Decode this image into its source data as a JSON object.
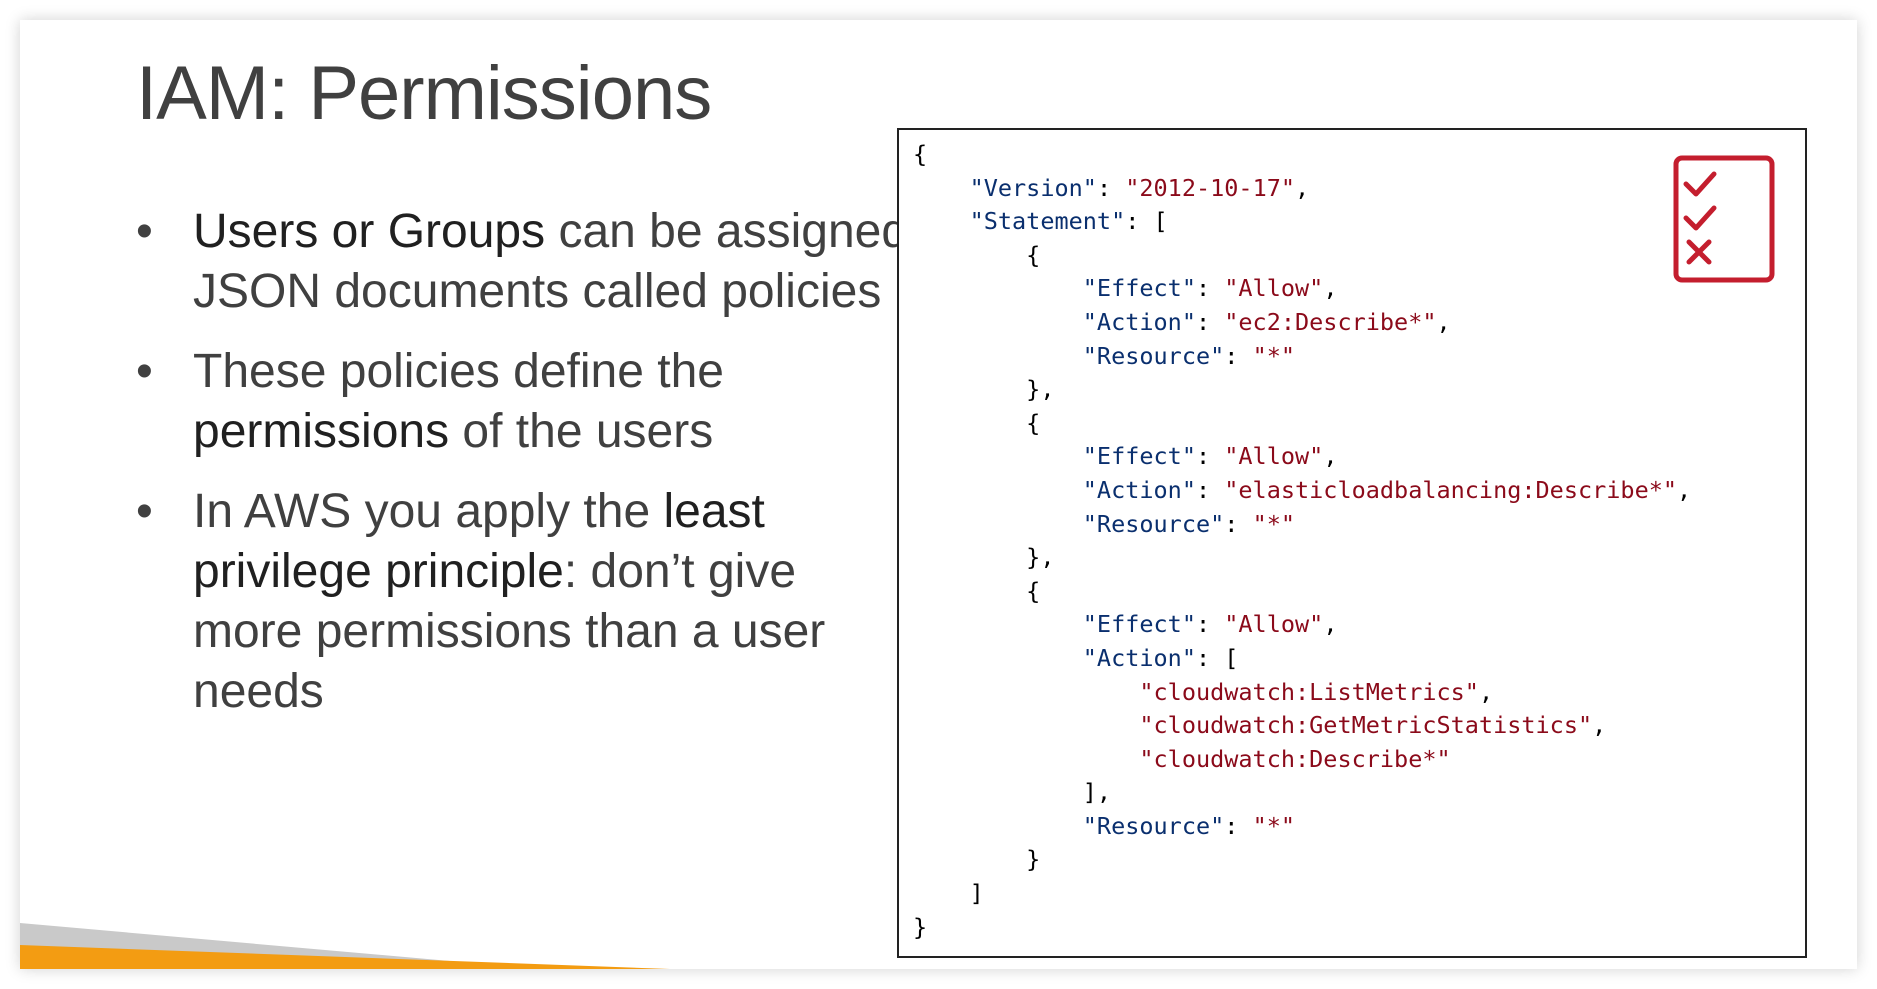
{
  "slide": {
    "title": "IAM: Permissions",
    "bullets": [
      [
        {
          "text": "Users or Groups",
          "em": true
        },
        {
          "text": " can be assigned JSON documents called policies",
          "em": false
        }
      ],
      [
        {
          "text": "These policies define the ",
          "em": false
        },
        {
          "text": "permissions",
          "em": true
        },
        {
          "text": " of the users",
          "em": false
        }
      ],
      [
        {
          "text": "In AWS you apply the ",
          "em": false
        },
        {
          "text": "least privilege principle",
          "em": true
        },
        {
          "text": ": don’t give more permissions than a user needs",
          "em": false
        }
      ]
    ]
  },
  "policy": {
    "lines": [
      [
        [
          "p",
          "{"
        ]
      ],
      [
        [
          "p",
          "    "
        ],
        [
          "k",
          "\"Version\""
        ],
        [
          "p",
          ": "
        ],
        [
          "s",
          "\"2012-10-17\""
        ],
        [
          "p",
          ","
        ]
      ],
      [
        [
          "p",
          "    "
        ],
        [
          "k",
          "\"Statement\""
        ],
        [
          "p",
          ": ["
        ]
      ],
      [
        [
          "p",
          "        {"
        ]
      ],
      [
        [
          "p",
          "            "
        ],
        [
          "k",
          "\"Effect\""
        ],
        [
          "p",
          ": "
        ],
        [
          "s",
          "\"Allow\""
        ],
        [
          "p",
          ","
        ]
      ],
      [
        [
          "p",
          "            "
        ],
        [
          "k",
          "\"Action\""
        ],
        [
          "p",
          ": "
        ],
        [
          "s",
          "\"ec2:Describe*\""
        ],
        [
          "p",
          ","
        ]
      ],
      [
        [
          "p",
          "            "
        ],
        [
          "k",
          "\"Resource\""
        ],
        [
          "p",
          ": "
        ],
        [
          "s",
          "\"*\""
        ]
      ],
      [
        [
          "p",
          "        },"
        ]
      ],
      [
        [
          "p",
          "        {"
        ]
      ],
      [
        [
          "p",
          "            "
        ],
        [
          "k",
          "\"Effect\""
        ],
        [
          "p",
          ": "
        ],
        [
          "s",
          "\"Allow\""
        ],
        [
          "p",
          ","
        ]
      ],
      [
        [
          "p",
          "            "
        ],
        [
          "k",
          "\"Action\""
        ],
        [
          "p",
          ": "
        ],
        [
          "s",
          "\"elasticloadbalancing:Describe*\""
        ],
        [
          "p",
          ","
        ]
      ],
      [
        [
          "p",
          "            "
        ],
        [
          "k",
          "\"Resource\""
        ],
        [
          "p",
          ": "
        ],
        [
          "s",
          "\"*\""
        ]
      ],
      [
        [
          "p",
          "        },"
        ]
      ],
      [
        [
          "p",
          "        {"
        ]
      ],
      [
        [
          "p",
          "            "
        ],
        [
          "k",
          "\"Effect\""
        ],
        [
          "p",
          ": "
        ],
        [
          "s",
          "\"Allow\""
        ],
        [
          "p",
          ","
        ]
      ],
      [
        [
          "p",
          "            "
        ],
        [
          "k",
          "\"Action\""
        ],
        [
          "p",
          ": ["
        ]
      ],
      [
        [
          "p",
          "                "
        ],
        [
          "s",
          "\"cloudwatch:ListMetrics\""
        ],
        [
          "p",
          ","
        ]
      ],
      [
        [
          "p",
          "                "
        ],
        [
          "s",
          "\"cloudwatch:GetMetricStatistics\""
        ],
        [
          "p",
          ","
        ]
      ],
      [
        [
          "p",
          "                "
        ],
        [
          "s",
          "\"cloudwatch:Describe*\""
        ]
      ],
      [
        [
          "p",
          "            ],"
        ]
      ],
      [
        [
          "p",
          "            "
        ],
        [
          "k",
          "\"Resource\""
        ],
        [
          "p",
          ": "
        ],
        [
          "s",
          "\"*\""
        ]
      ],
      [
        [
          "p",
          "        }"
        ]
      ],
      [
        [
          "p",
          "    ]"
        ]
      ],
      [
        [
          "p",
          "}"
        ]
      ]
    ]
  },
  "icons": {
    "checklist": [
      "check",
      "check",
      "cross"
    ]
  },
  "colors": {
    "text": "#404040",
    "json_key": "#0a2f6e",
    "json_string": "#8b0a1a",
    "checklist": "#c41e2e",
    "band_orange": "#f39c12",
    "band_gray": "#c9c9c9"
  }
}
